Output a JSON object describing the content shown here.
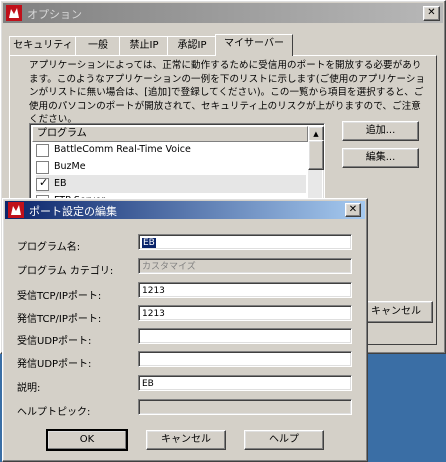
{
  "options_window": {
    "title": "オプション",
    "close_label": "✕",
    "tabs": [
      {
        "label": "セキュリティ"
      },
      {
        "label": "一般"
      },
      {
        "label": "禁止IP"
      },
      {
        "label": "承認IP"
      },
      {
        "label": "マイサーバー"
      }
    ],
    "description": "アプリケーションによっては、正常に動作するために受信用のポートを開放する必要があります。このようなアプリケーションの一例を下のリストに示します(ご使用のアプリケーションがリストに無い場合は、[追加]で登録してください)。この一覧から項目を選択すると、ご使用のパソコンのポートが開放されて、セキュリティ上のリスクが上がりますので、ご注意ください。",
    "list_header": "プログラム",
    "programs": [
      {
        "label": "BattleComm Real-Time Voice",
        "checked": false
      },
      {
        "label": "BuzMe",
        "checked": false
      },
      {
        "label": "EB",
        "checked": true
      },
      {
        "label": "FTP Server",
        "checked": false
      }
    ],
    "add_button": "追加...",
    "edit_button": "編集...",
    "cancel_button": "キャンセル"
  },
  "dialog": {
    "title": "ポート設定の編集",
    "close_label": "✕",
    "fields": {
      "program_name": {
        "label": "プログラム名:",
        "value": "EB"
      },
      "program_category": {
        "label": "プログラム カテゴリ:",
        "value": "カスタマイズ"
      },
      "recv_tcp": {
        "label": "受信TCP/IPポート:",
        "value": "1213"
      },
      "send_tcp": {
        "label": "発信TCP/IPポート:",
        "value": "1213"
      },
      "recv_udp": {
        "label": "受信UDPポート:",
        "value": ""
      },
      "send_udp": {
        "label": "発信UDPポート:",
        "value": ""
      },
      "description": {
        "label": "説明:",
        "value": "EB"
      },
      "help_topic": {
        "label": "ヘルプトピック:",
        "value": ""
      }
    },
    "ok_button": "OK",
    "cancel_button": "キャンセル",
    "help_button": "ヘルプ"
  },
  "colors": {
    "desktop": "#3a6ea5",
    "active_title": "#0a246a",
    "inactive_title": "#808080",
    "face": "#d4d0c8",
    "app_icon": "#c0101a"
  },
  "icons": {
    "app_icon": "red-flame-logo-icon",
    "check": "checkmark-icon"
  }
}
